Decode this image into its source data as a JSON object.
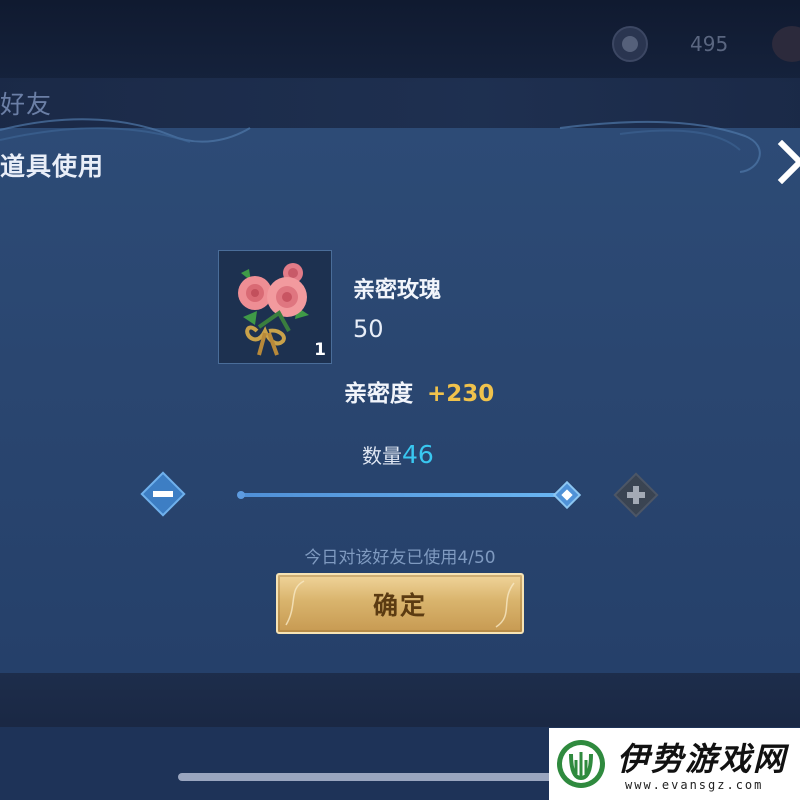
{
  "topbar": {
    "currency_value": "495",
    "currency_icon": "coin-icon"
  },
  "background_title": "好友",
  "dialog": {
    "title": "道具使用",
    "close_icon": "close-chevron-icon",
    "item": {
      "name": "亲密玫瑰",
      "value": "50",
      "count": "1",
      "icon": "rose-bouquet-icon"
    },
    "intimacy": {
      "label": "亲密度",
      "bonus": "+230"
    },
    "quantity": {
      "label": "数量",
      "value": "46",
      "slider_fraction": 0.99
    },
    "usage_text": "今日对该好友已使用4/50",
    "confirm_label": "确定"
  },
  "watermark": {
    "name": "伊势游戏网",
    "url": "www.evansgz.com"
  },
  "colors": {
    "panel": "#2a4670",
    "accent_blue": "#39c7f0",
    "gold": "#f0c24c",
    "confirm_button": "#d9b46d"
  }
}
